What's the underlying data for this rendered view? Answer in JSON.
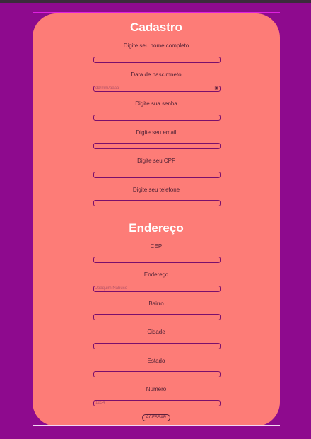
{
  "cadastro": {
    "title": "Cadastro",
    "nome_label": "Digite seu nome completo",
    "nascimento_label": "Data de nascimneto",
    "nascimento_placeholder": "dd/mm/aaaa",
    "senha_label": "Digite sua senha",
    "email_label": "Digite seu email",
    "cpf_label": "Digite seu CPF",
    "telefone_label": "Digite seu telefone"
  },
  "endereco": {
    "title": "Endereço",
    "cep_label": "CEP",
    "endereco_label": "Endereço",
    "endereco_placeholder": "Joaquim Nabuco",
    "bairro_label": "Bairro",
    "cidade_label": "Cidade",
    "estado_label": "Estado",
    "numero_label": "Número",
    "numero_placeholder": "1234"
  },
  "submit_label": "ACESSAR",
  "colors": {
    "background": "#8e0a8e",
    "card": "#fd7c77",
    "accent_border": "#7a0f6c"
  }
}
